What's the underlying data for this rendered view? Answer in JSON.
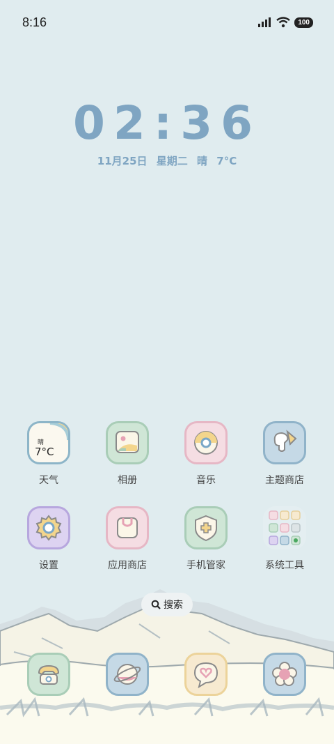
{
  "status": {
    "time": "8:16",
    "battery": "100"
  },
  "clock": {
    "time": "02:36"
  },
  "date": {
    "date": "11月25日",
    "weekday": "星期二",
    "weather": "晴",
    "temp": "7°C"
  },
  "weather_widget": {
    "condition": "晴",
    "temp": "7°C"
  },
  "apps": [
    {
      "label": "天气",
      "icon": "weather-icon"
    },
    {
      "label": "相册",
      "icon": "gallery-icon"
    },
    {
      "label": "音乐",
      "icon": "music-icon"
    },
    {
      "label": "主题商店",
      "icon": "theme-store-icon"
    },
    {
      "label": "设置",
      "icon": "settings-icon"
    },
    {
      "label": "应用商店",
      "icon": "app-store-icon"
    },
    {
      "label": "手机管家",
      "icon": "phone-manager-icon"
    },
    {
      "label": "系统工具",
      "icon": "system-tools-folder-icon"
    }
  ],
  "search": {
    "label": "搜索"
  },
  "dock": [
    {
      "icon": "phone-icon"
    },
    {
      "icon": "browser-icon"
    },
    {
      "icon": "messages-icon"
    },
    {
      "icon": "camera-icon"
    }
  ],
  "colors": {
    "clock": "#7fa5c2",
    "background": "#e0ecef"
  }
}
